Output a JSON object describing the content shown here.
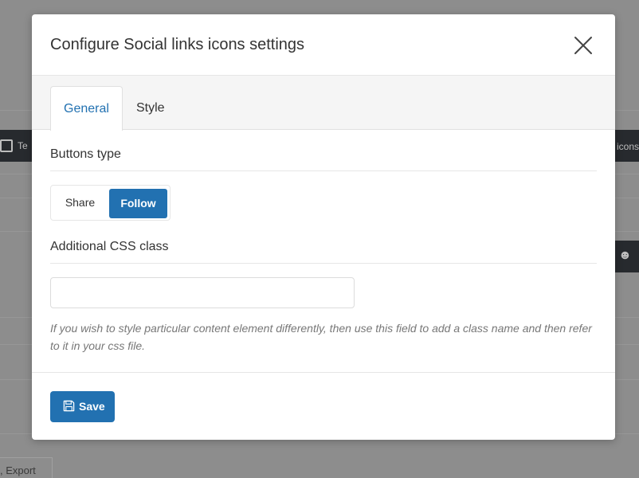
{
  "background": {
    "bar_left_text": "Te",
    "bar_right_text": "icons",
    "export_text": ", Export"
  },
  "modal": {
    "title": "Configure Social links icons settings",
    "close_icon": "close-icon",
    "tabs": [
      {
        "label": "General",
        "active": true
      },
      {
        "label": "Style",
        "active": false
      }
    ],
    "buttons_type": {
      "label": "Buttons type",
      "options": [
        {
          "label": "Share",
          "selected": false
        },
        {
          "label": "Follow",
          "selected": true
        }
      ]
    },
    "css_class": {
      "label": "Additional CSS class",
      "value": "",
      "help": "If you wish to style particular content element differently, then use this field to add a class name and then refer to it in your css file."
    },
    "save_label": "Save",
    "save_icon": "floppy-disk-icon"
  },
  "colors": {
    "accent": "#2271b1",
    "overlay": "#8d8d8d",
    "dark_bar": "#272a2e"
  }
}
